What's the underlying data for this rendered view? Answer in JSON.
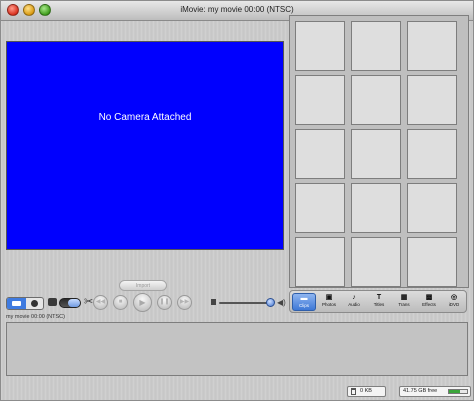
{
  "window": {
    "title": "iMovie: my movie  00:00 (NTSC)"
  },
  "monitor": {
    "message": "No Camera Attached",
    "background_color": "#0000fe"
  },
  "shelf": {
    "rows": 5,
    "columns": 3
  },
  "controls": {
    "import_label": "Import",
    "transport_icons": [
      "rewind-icon",
      "stop-icon",
      "play-icon",
      "pause-icon",
      "fast-forward-icon"
    ]
  },
  "panes": [
    {
      "label": "Clips",
      "icon": "clips-icon",
      "selected": true
    },
    {
      "label": "Photos",
      "icon": "photos-icon",
      "selected": false
    },
    {
      "label": "Audio",
      "icon": "audio-icon",
      "selected": false
    },
    {
      "label": "Titles",
      "icon": "titles-icon",
      "selected": false
    },
    {
      "label": "Trans",
      "icon": "transitions-icon",
      "selected": false
    },
    {
      "label": "Effects",
      "icon": "effects-icon",
      "selected": false
    },
    {
      "label": "iDVD",
      "icon": "idvd-icon",
      "selected": false
    }
  ],
  "status": {
    "movie_info": "my movie  00:00 (NTSC)",
    "trash_size": "0 KB",
    "free_space": "41.75 GB free",
    "free_fraction": 0.6
  }
}
